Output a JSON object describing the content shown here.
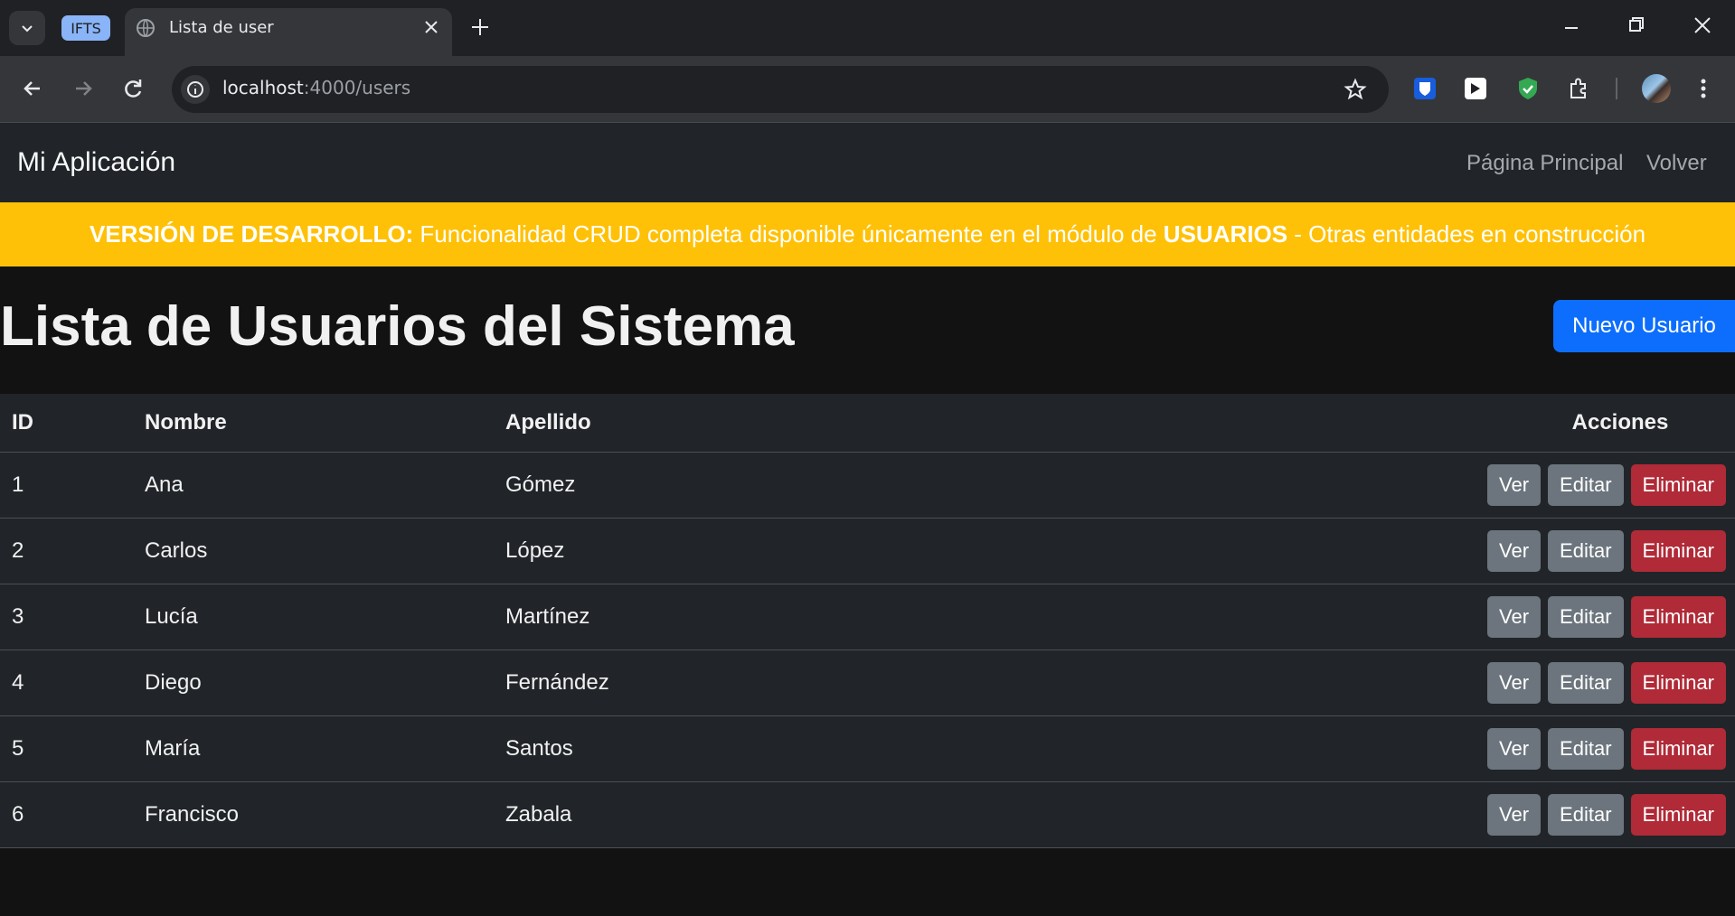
{
  "browser": {
    "tab_group": "IFTS",
    "tab_title": "Lista de user",
    "url_host": "localhost",
    "url_path": ":4000/users"
  },
  "app": {
    "brand": "Mi Aplicación",
    "nav_links": [
      "Página Principal",
      "Volver"
    ],
    "alert": {
      "strong_prefix": "VERSIÓN DE DESARROLLO:",
      "middle_text": " Funcionalidad CRUD completa disponible únicamente en el módulo de ",
      "strong_word": "USUARIOS",
      "suffix": " - Otras entidades en construcción"
    },
    "page_title": "Lista de Usuarios del Sistema",
    "new_user_button": "Nuevo Usuario",
    "table": {
      "headers": [
        "ID",
        "Nombre",
        "Apellido",
        "Acciones"
      ],
      "rows": [
        {
          "id": "1",
          "nombre": "Ana",
          "apellido": "Gómez"
        },
        {
          "id": "2",
          "nombre": "Carlos",
          "apellido": "López"
        },
        {
          "id": "3",
          "nombre": "Lucía",
          "apellido": "Martínez"
        },
        {
          "id": "4",
          "nombre": "Diego",
          "apellido": "Fernández"
        },
        {
          "id": "5",
          "nombre": "María",
          "apellido": "Santos"
        },
        {
          "id": "6",
          "nombre": "Francisco",
          "apellido": "Zabala"
        }
      ],
      "actions": {
        "view": "Ver",
        "edit": "Editar",
        "delete": "Eliminar"
      }
    }
  }
}
